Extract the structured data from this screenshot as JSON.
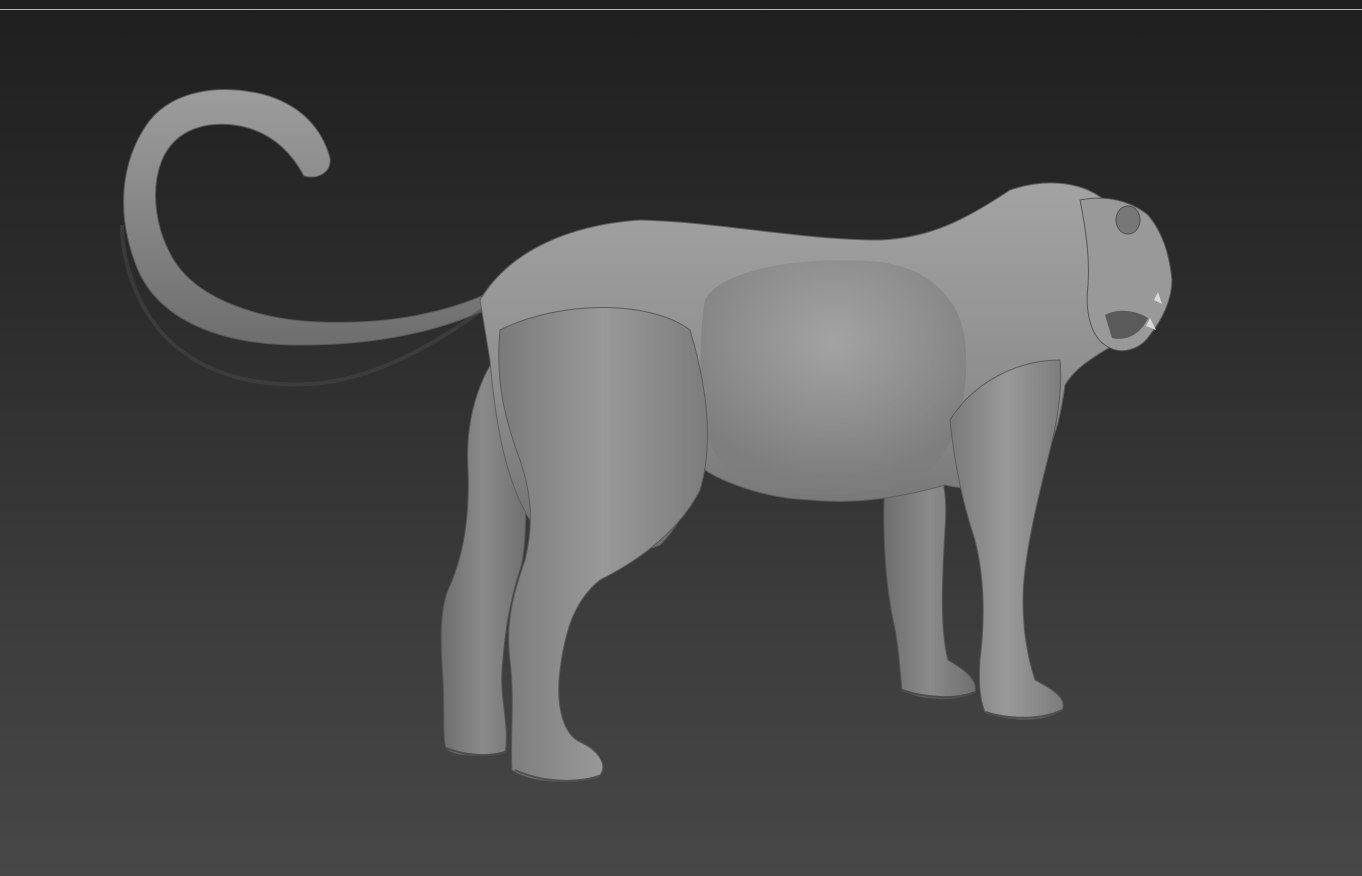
{
  "viewport": {
    "active_border_color": "#c9c73a",
    "background_top": "#1f1f1f",
    "background_bottom": "#474747",
    "model": {
      "subject": "panther-sculpt",
      "material_color": "#8f8f8f"
    }
  }
}
